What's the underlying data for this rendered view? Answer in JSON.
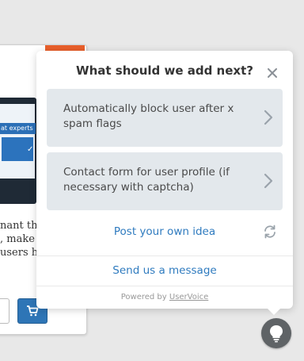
{
  "background": {
    "banner_text": "at experts",
    "body_lines": [
      "nant them",
      ", make yo",
      " users ha"
    ],
    "check_glyph": "✓",
    "cart_icon": "cart-icon"
  },
  "popup": {
    "title": "What should we add next?",
    "close_icon": "close-icon",
    "ideas": [
      {
        "label": "Automatically block user after x spam flags",
        "icon": "chevron-right-icon"
      },
      {
        "label": "Contact form for user profile (if necessary with captcha)",
        "icon": "chevron-right-icon"
      }
    ],
    "post_idea_label": "Post your own idea",
    "refresh_icon": "refresh-icon",
    "send_message_label": "Send us a message",
    "powered_prefix": "Powered by",
    "powered_link": "UserVoice"
  },
  "launcher": {
    "icon": "lightbulb-icon"
  },
  "colors": {
    "link": "#2f7bbf",
    "card": "#e3e8ec",
    "launcher": "#5f6366",
    "accent_orange": "#e95f2b"
  }
}
